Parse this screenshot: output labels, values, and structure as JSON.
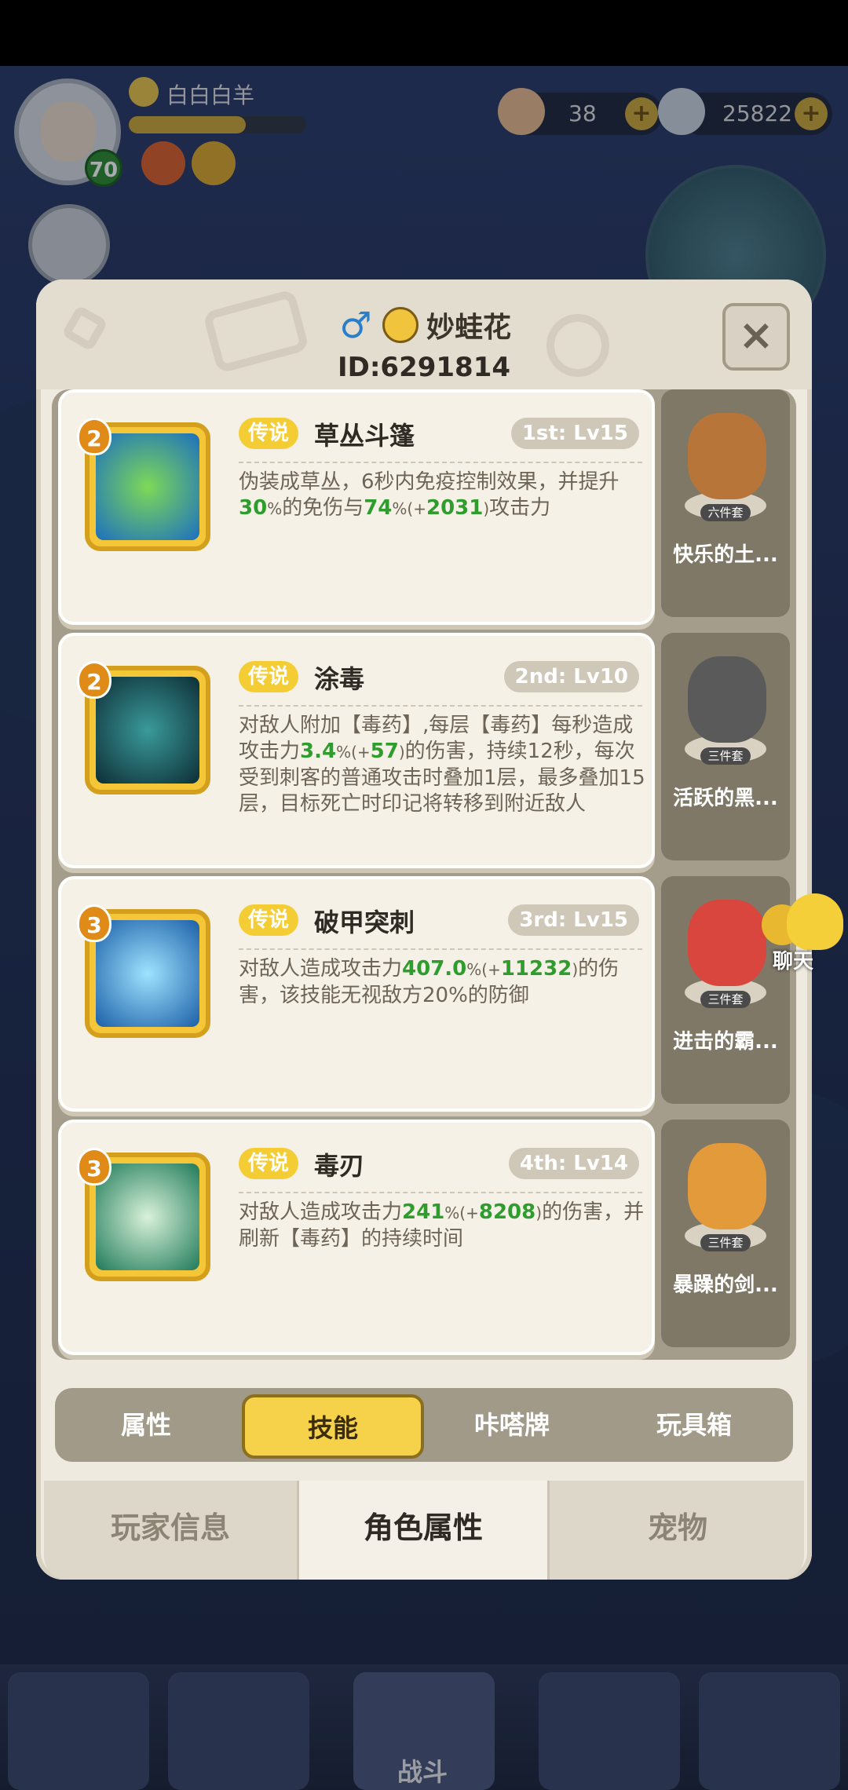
{
  "hud": {
    "player_name": "白白白羊",
    "level": "70",
    "currency1": "38",
    "currency2": "25822",
    "plus": "+"
  },
  "panel": {
    "username": "妙蛙花",
    "user_id": "ID:6291814",
    "close": "×"
  },
  "skills": [
    {
      "num": "2",
      "rarity": "传说",
      "name": "草丛斗篷",
      "level": "1st: Lv15",
      "desc_html": "伪装成草丛，6秒内免疫控制效果，并提升<span class='g'>30</span><span class='s'>%</span>的免伤与<span class='g'>74</span><span class='s'>%(+</span><span class='g'>2031</span><span class='s'>)</span>攻击力",
      "color": "#3bb34a"
    },
    {
      "num": "2",
      "rarity": "传说",
      "name": "涂毒",
      "level": "2nd: Lv10",
      "desc_html": "对敌人附加【毒药】,每层【毒药】每秒造成攻击力<span class='g'>3.4</span><span class='s'>%(+</span><span class='g'>57</span><span class='s'>)</span>的伤害，持续12秒，每次受到刺客的普通攻击时叠加1层，最多叠加15层，目标死亡时印记将转移到附近敌人",
      "color": "#1f5f63"
    },
    {
      "num": "3",
      "rarity": "传说",
      "name": "破甲突刺",
      "level": "3rd: Lv15",
      "desc_html": "对敌人造成攻击力<span class='g'>407.0</span><span class='s'>%(+</span><span class='g'>11232</span><span class='s'>)</span>的伤害，该技能无视敌方20%的防御",
      "color": "#2b8bc4"
    },
    {
      "num": "3",
      "rarity": "传说",
      "name": "毒刃",
      "level": "4th: Lv14",
      "desc_html": "对敌人造成攻击力<span class='g'>241</span><span class='s'>%(+</span><span class='g'>8208</span><span class='s'>)</span>的伤害，并刷新【毒药】的持续时间",
      "color": "#2f8f5a"
    }
  ],
  "sets": [
    {
      "tag": "六件套",
      "name": "快乐的土...",
      "color": "#b7753a"
    },
    {
      "tag": "三件套",
      "name": "活跃的黑...",
      "color": "#5a5a5a"
    },
    {
      "tag": "三件套",
      "name": "进击的霸...",
      "color": "#d8463e"
    },
    {
      "tag": "三件套",
      "name": "暴躁的剑...",
      "color": "#e39a3a"
    }
  ],
  "tabs": [
    "属性",
    "技能",
    "咔嗒牌",
    "玩具箱"
  ],
  "bottom_tabs": [
    "玩家信息",
    "角色属性",
    "宠物"
  ],
  "chat": "聊天",
  "nav": {
    "fight": "战斗"
  }
}
